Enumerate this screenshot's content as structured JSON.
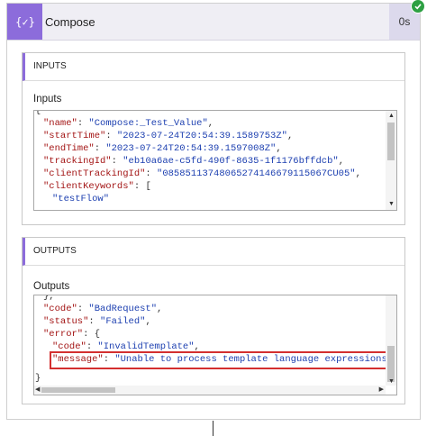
{
  "action": {
    "title": "Compose",
    "duration": "0s",
    "icon": "curly-braces-icon",
    "status_icon": "success-check-icon",
    "accent_color": "#8c6cdb",
    "status_color": "#2ea043"
  },
  "inputs": {
    "section_title": "INPUTS",
    "field_label": "Inputs",
    "lines": [
      {
        "key": "",
        "value": "",
        "punct": "{"
      },
      {
        "key": "\"name\"",
        "sep": ": ",
        "value": "\"Compose:_Test_Value\"",
        "punct": ","
      },
      {
        "key": "\"startTime\"",
        "sep": ": ",
        "value": "\"2023-07-24T20:54:39.1589753Z\"",
        "punct": ","
      },
      {
        "key": "\"endTime\"",
        "sep": ": ",
        "value": "\"2023-07-24T20:54:39.1597008Z\"",
        "punct": ","
      },
      {
        "key": "\"trackingId\"",
        "sep": ": ",
        "value": "\"eb10a6ae-c5fd-490f-8635-1f1176bffdcb\"",
        "punct": ","
      },
      {
        "key": "\"clientTrackingId\"",
        "sep": ": ",
        "value": "\"08585113748065274146679115067CU05\"",
        "punct": ","
      },
      {
        "key": "\"clientKeywords\"",
        "sep": ": ",
        "value": "",
        "punct": "["
      },
      {
        "key": "",
        "sep": "",
        "value": "\"testFlow\"",
        "punct": ""
      }
    ]
  },
  "outputs": {
    "section_title": "OUTPUTS",
    "field_label": "Outputs",
    "lines": [
      {
        "key": "",
        "sep": "",
        "value": "",
        "punct": "},"
      },
      {
        "key": "\"code\"",
        "sep": ": ",
        "value": "\"BadRequest\"",
        "punct": ","
      },
      {
        "key": "\"status\"",
        "sep": ": ",
        "value": "\"Failed\"",
        "punct": ","
      },
      {
        "key": "\"error\"",
        "sep": ": ",
        "value": "",
        "punct": "{"
      },
      {
        "key": "\"code\"",
        "sep": ": ",
        "value": "\"InvalidTemplate\"",
        "punct": ","
      },
      {
        "key": "\"message\"",
        "sep": ": ",
        "value": "\"Unable to process template language expressions in",
        "punct": ""
      },
      {
        "key": "",
        "sep": "",
        "value": "",
        "punct": "}"
      }
    ],
    "highlight_color": "#d32f2f"
  }
}
